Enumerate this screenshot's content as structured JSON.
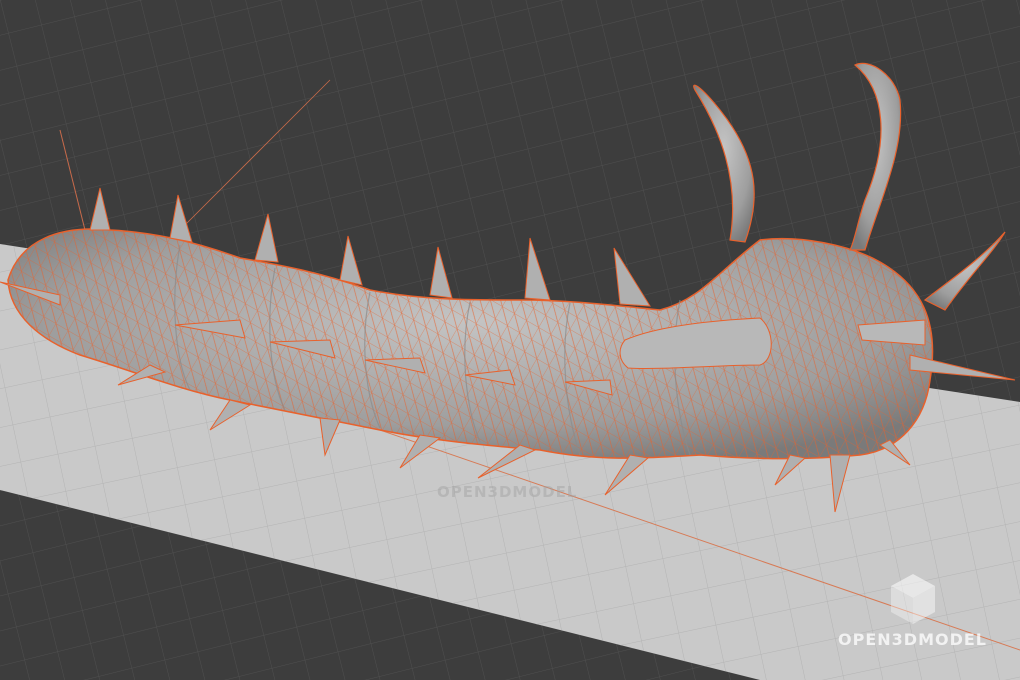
{
  "viewport": {
    "background_color": "#3d3d3d",
    "grid_color": "#4f4f4f",
    "floor_color": "#c9c9c9",
    "floor_grid_color": "#b4b4b4",
    "body_color": "#a9a9a9",
    "wire_color": "#e8612c",
    "axis_color": "#c86a4a"
  },
  "watermarks": {
    "center_text": "OPEN3DMODEL",
    "corner_text": "OPEN3DMODEL",
    "logo_icon": "cube-icon"
  }
}
